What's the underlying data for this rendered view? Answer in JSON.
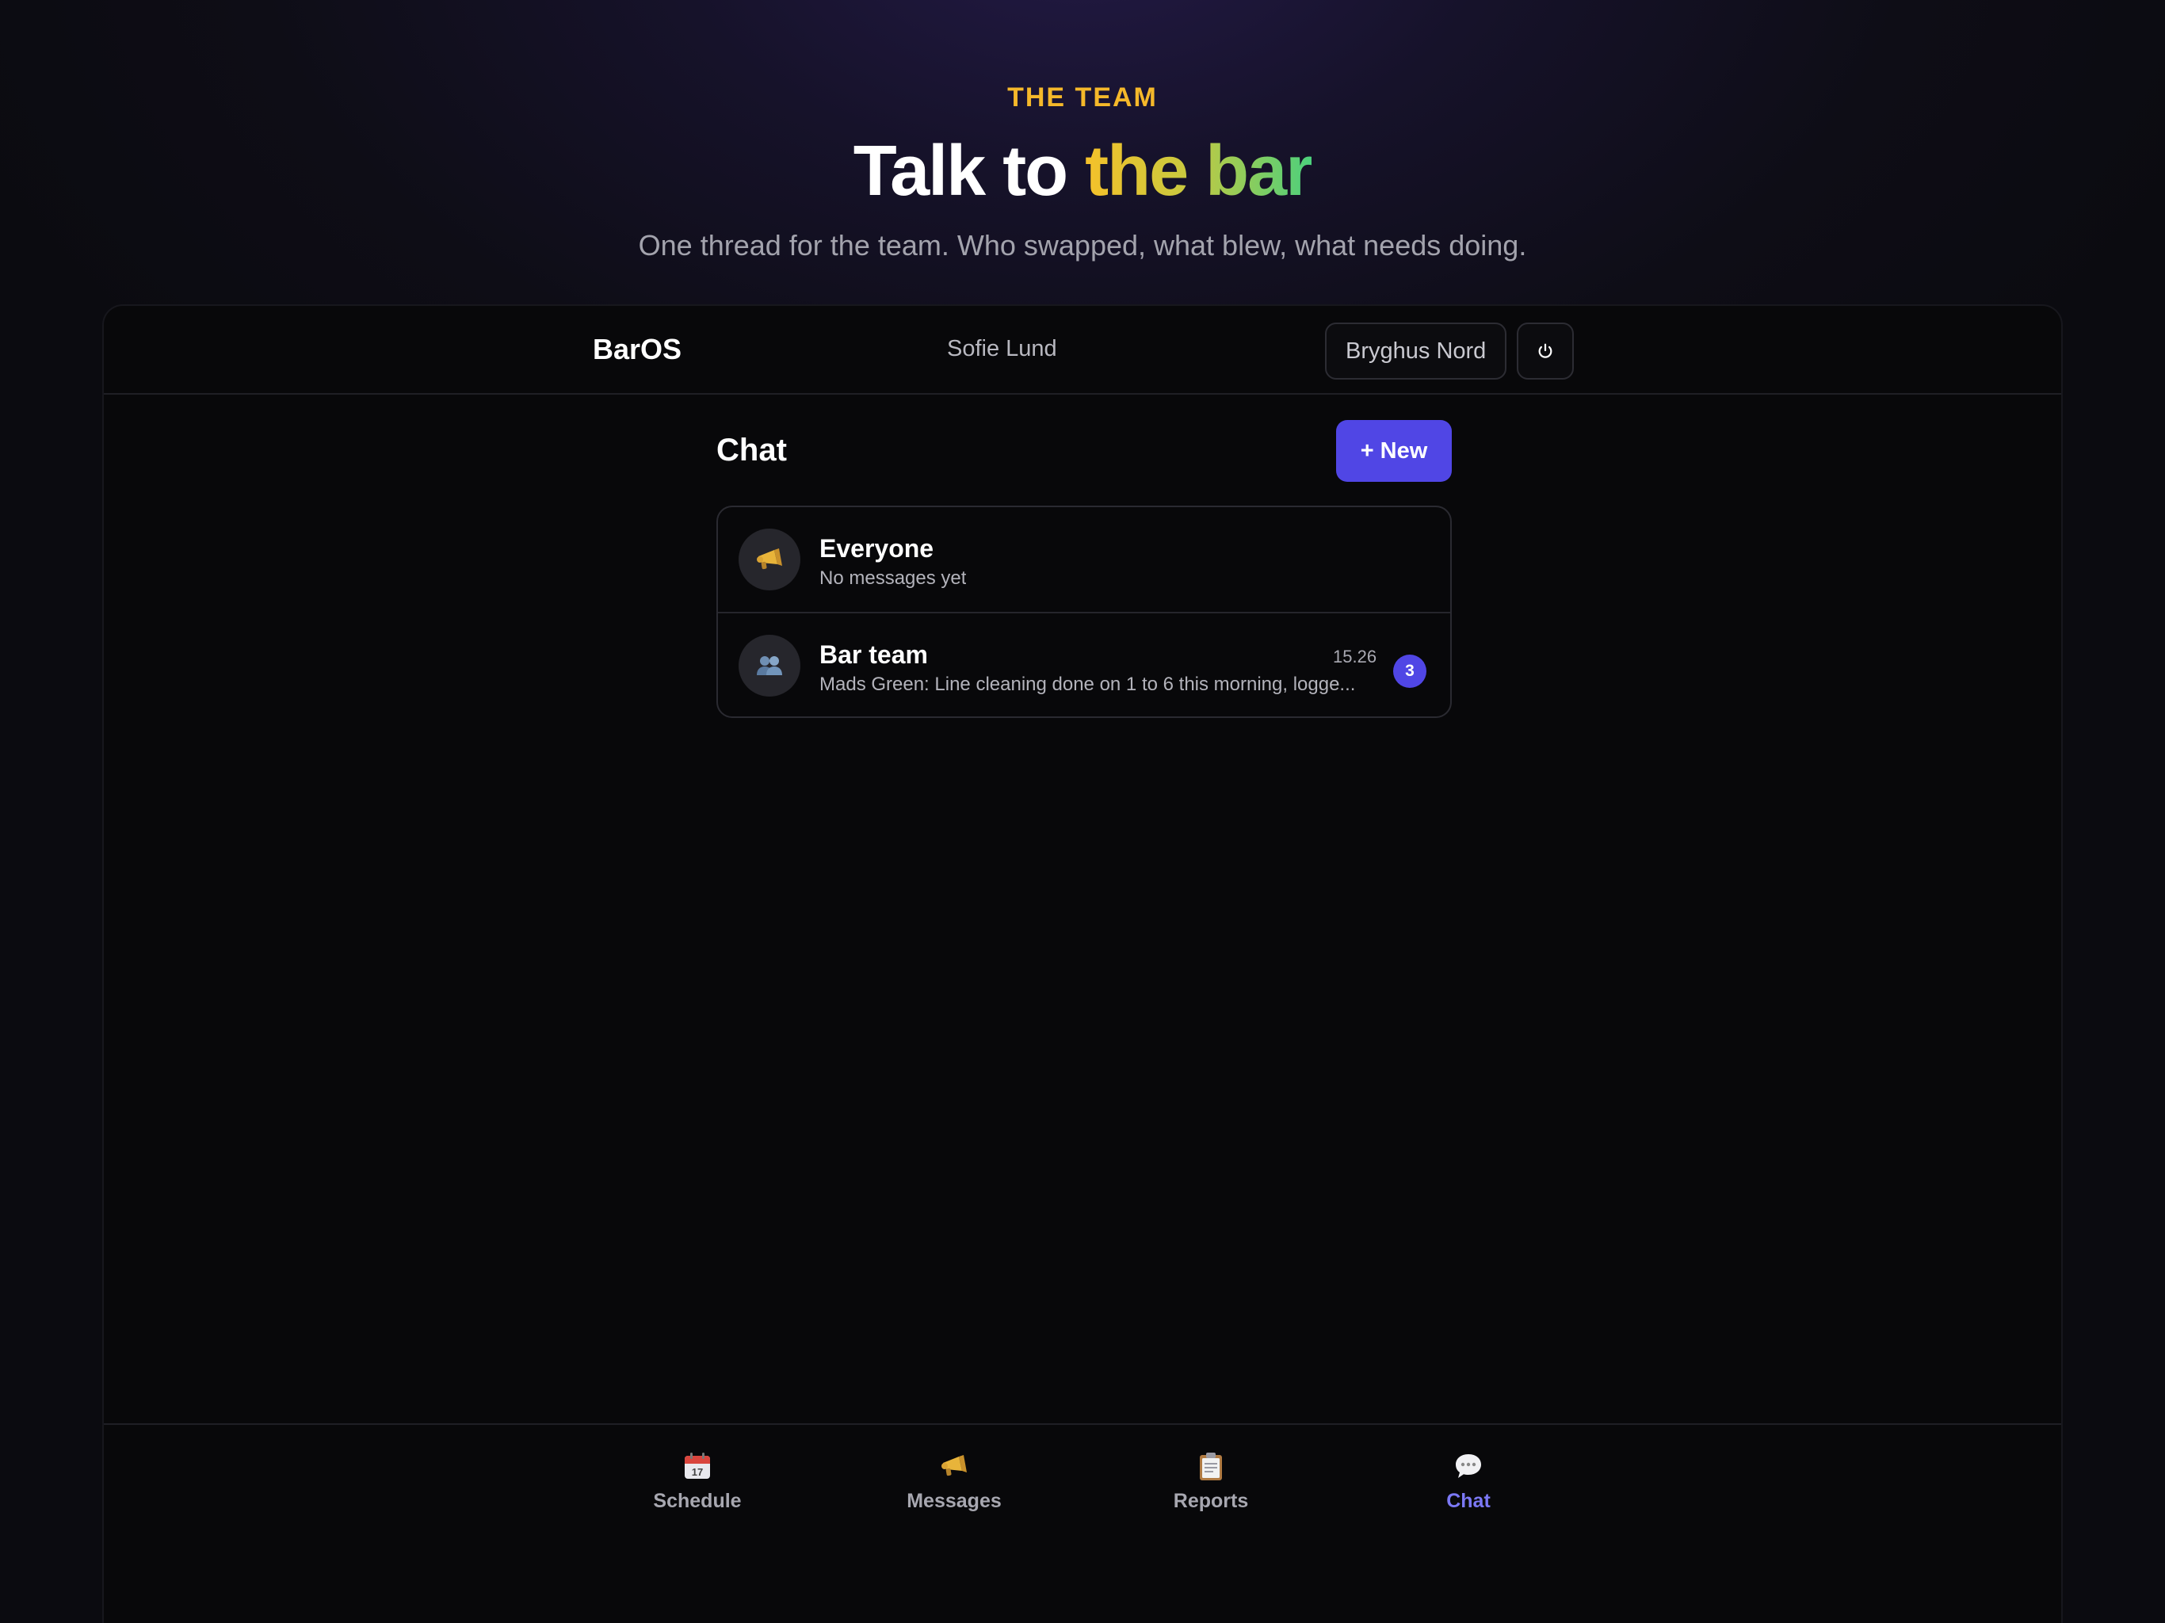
{
  "hero": {
    "eyebrow": "THE TEAM",
    "headline_plain": "Talk to ",
    "headline_highlight": "the bar",
    "subhead": "One thread for the team. Who swapped, what blew, what needs doing."
  },
  "topbar": {
    "brand": "BarOS",
    "user_name": "Sofie Lund",
    "venue": "Bryghus Nord",
    "power_icon": "power-icon"
  },
  "chat": {
    "title": "Chat",
    "new_button": "+ New",
    "conversations": [
      {
        "icon": "megaphone-icon",
        "name": "Everyone",
        "preview": "No messages yet",
        "time": "",
        "unread": ""
      },
      {
        "icon": "people-icon",
        "name": "Bar team",
        "preview": "Mads Green: Line cleaning done on 1 to 6 this morning, logge...",
        "time": "15.26",
        "unread": "3"
      }
    ]
  },
  "nav": {
    "items": [
      {
        "label": "Schedule",
        "icon": "calendar-icon",
        "active": false
      },
      {
        "label": "Messages",
        "icon": "megaphone-icon",
        "active": false
      },
      {
        "label": "Reports",
        "icon": "clipboard-icon",
        "active": false
      },
      {
        "label": "Chat",
        "icon": "speech-bubble-icon",
        "active": true
      }
    ]
  },
  "colors": {
    "accent": "#5046e5",
    "active_nav": "#7b78f5",
    "eyebrow": "#f5b82a",
    "highlight_start": "#f5c12a",
    "highlight_end": "#4cd07c"
  }
}
